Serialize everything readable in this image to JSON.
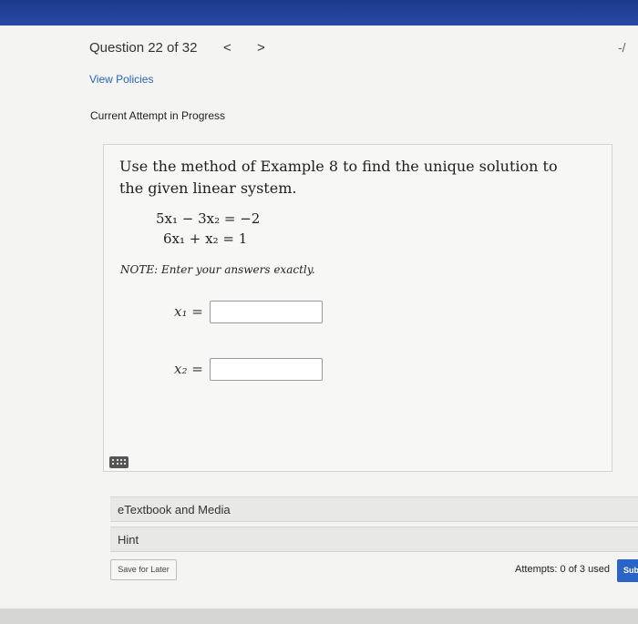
{
  "header": {
    "question_counter": "Question 22 of 32",
    "prev_arrow": "<",
    "next_arrow": ">",
    "score": "-/"
  },
  "links": {
    "view_policies": "View Policies"
  },
  "status": "Current Attempt in Progress",
  "question": {
    "prompt": "Use the method of Example 8 to find the unique solution to the given linear system.",
    "equations": [
      "5x₁ − 3x₂ = −2",
      "6x₁ + x₂ = 1"
    ],
    "note": "NOTE: Enter your answers exactly.",
    "answers": [
      {
        "label": "x₁ =",
        "value": ""
      },
      {
        "label": "x₂ =",
        "value": ""
      }
    ]
  },
  "resources": {
    "etextbook_label": "eTextbook and Media",
    "hint_label": "Hint"
  },
  "footer": {
    "save_label": "Save for Later",
    "attempts_text": "Attempts: 0 of 3 used",
    "submit_label": "Sub"
  },
  "icons": {
    "keyboard": "keyboard-icon"
  },
  "colors": {
    "topbar": "#1b3b8a",
    "link": "#2a64b7",
    "submit": "#2b63c7"
  }
}
